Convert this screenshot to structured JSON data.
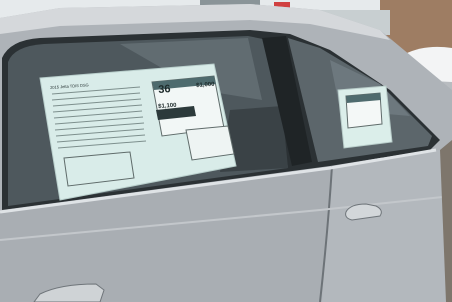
{
  "scene": {
    "description_free": true,
    "colors": {
      "car_body": "#aeb3b8",
      "car_shadow": "#6f757b",
      "window_dark": "#2a3033",
      "sticker": "#d8ecea",
      "sky": "#e4e8ea",
      "brick": "#9c7b63"
    }
  },
  "front_sticker": {
    "title": "2015 Jetta TDIS DSG",
    "mpg": "36",
    "fuel_cost": "$1,000",
    "savings": "$1,100"
  }
}
